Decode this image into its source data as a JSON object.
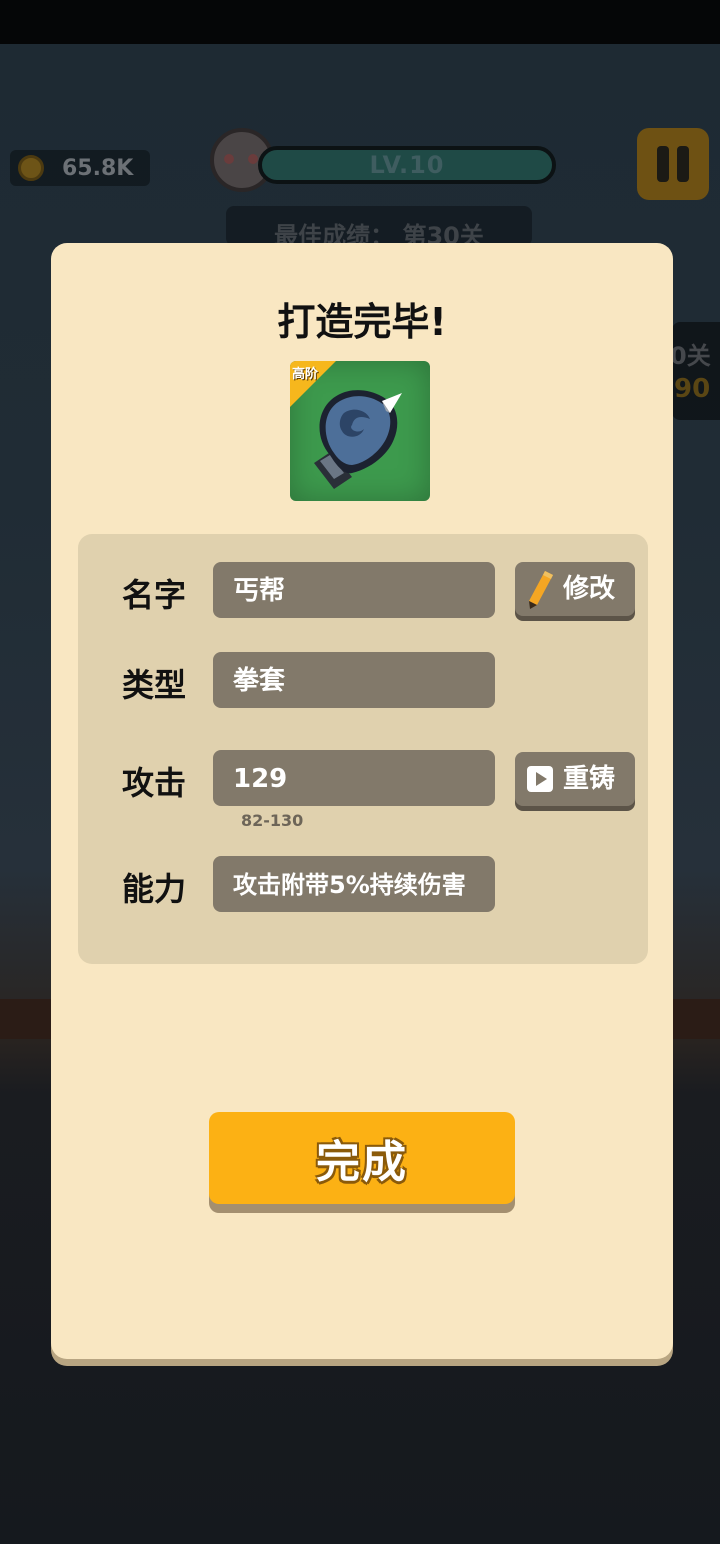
{
  "hud": {
    "coins": "65.8K",
    "level": "LV.10",
    "best_score": "最佳成绩：  第30关",
    "side_stage_text": "0关",
    "side_stage_value": "90"
  },
  "modal": {
    "title": "打造完毕!",
    "item": {
      "rank": "高阶",
      "icon": "boxing-glove-icon",
      "card_color": "#3d9a4d"
    },
    "rows": {
      "name_label": "名字",
      "name_value": "丐帮",
      "rename_button": "修改",
      "type_label": "类型",
      "type_value": "拳套",
      "attack_label": "攻击",
      "attack_value": "129",
      "attack_range": "82-130",
      "reforge_button": "重铸",
      "ability_label": "能力",
      "ability_value": "攻击附带5%持续伤害"
    },
    "done_button": "完成"
  },
  "colors": {
    "modal_bg": "#f9e7c2",
    "panel_bg": "#e0d1ae",
    "field_bg": "#82796a",
    "primary_button": "#fcb114"
  }
}
